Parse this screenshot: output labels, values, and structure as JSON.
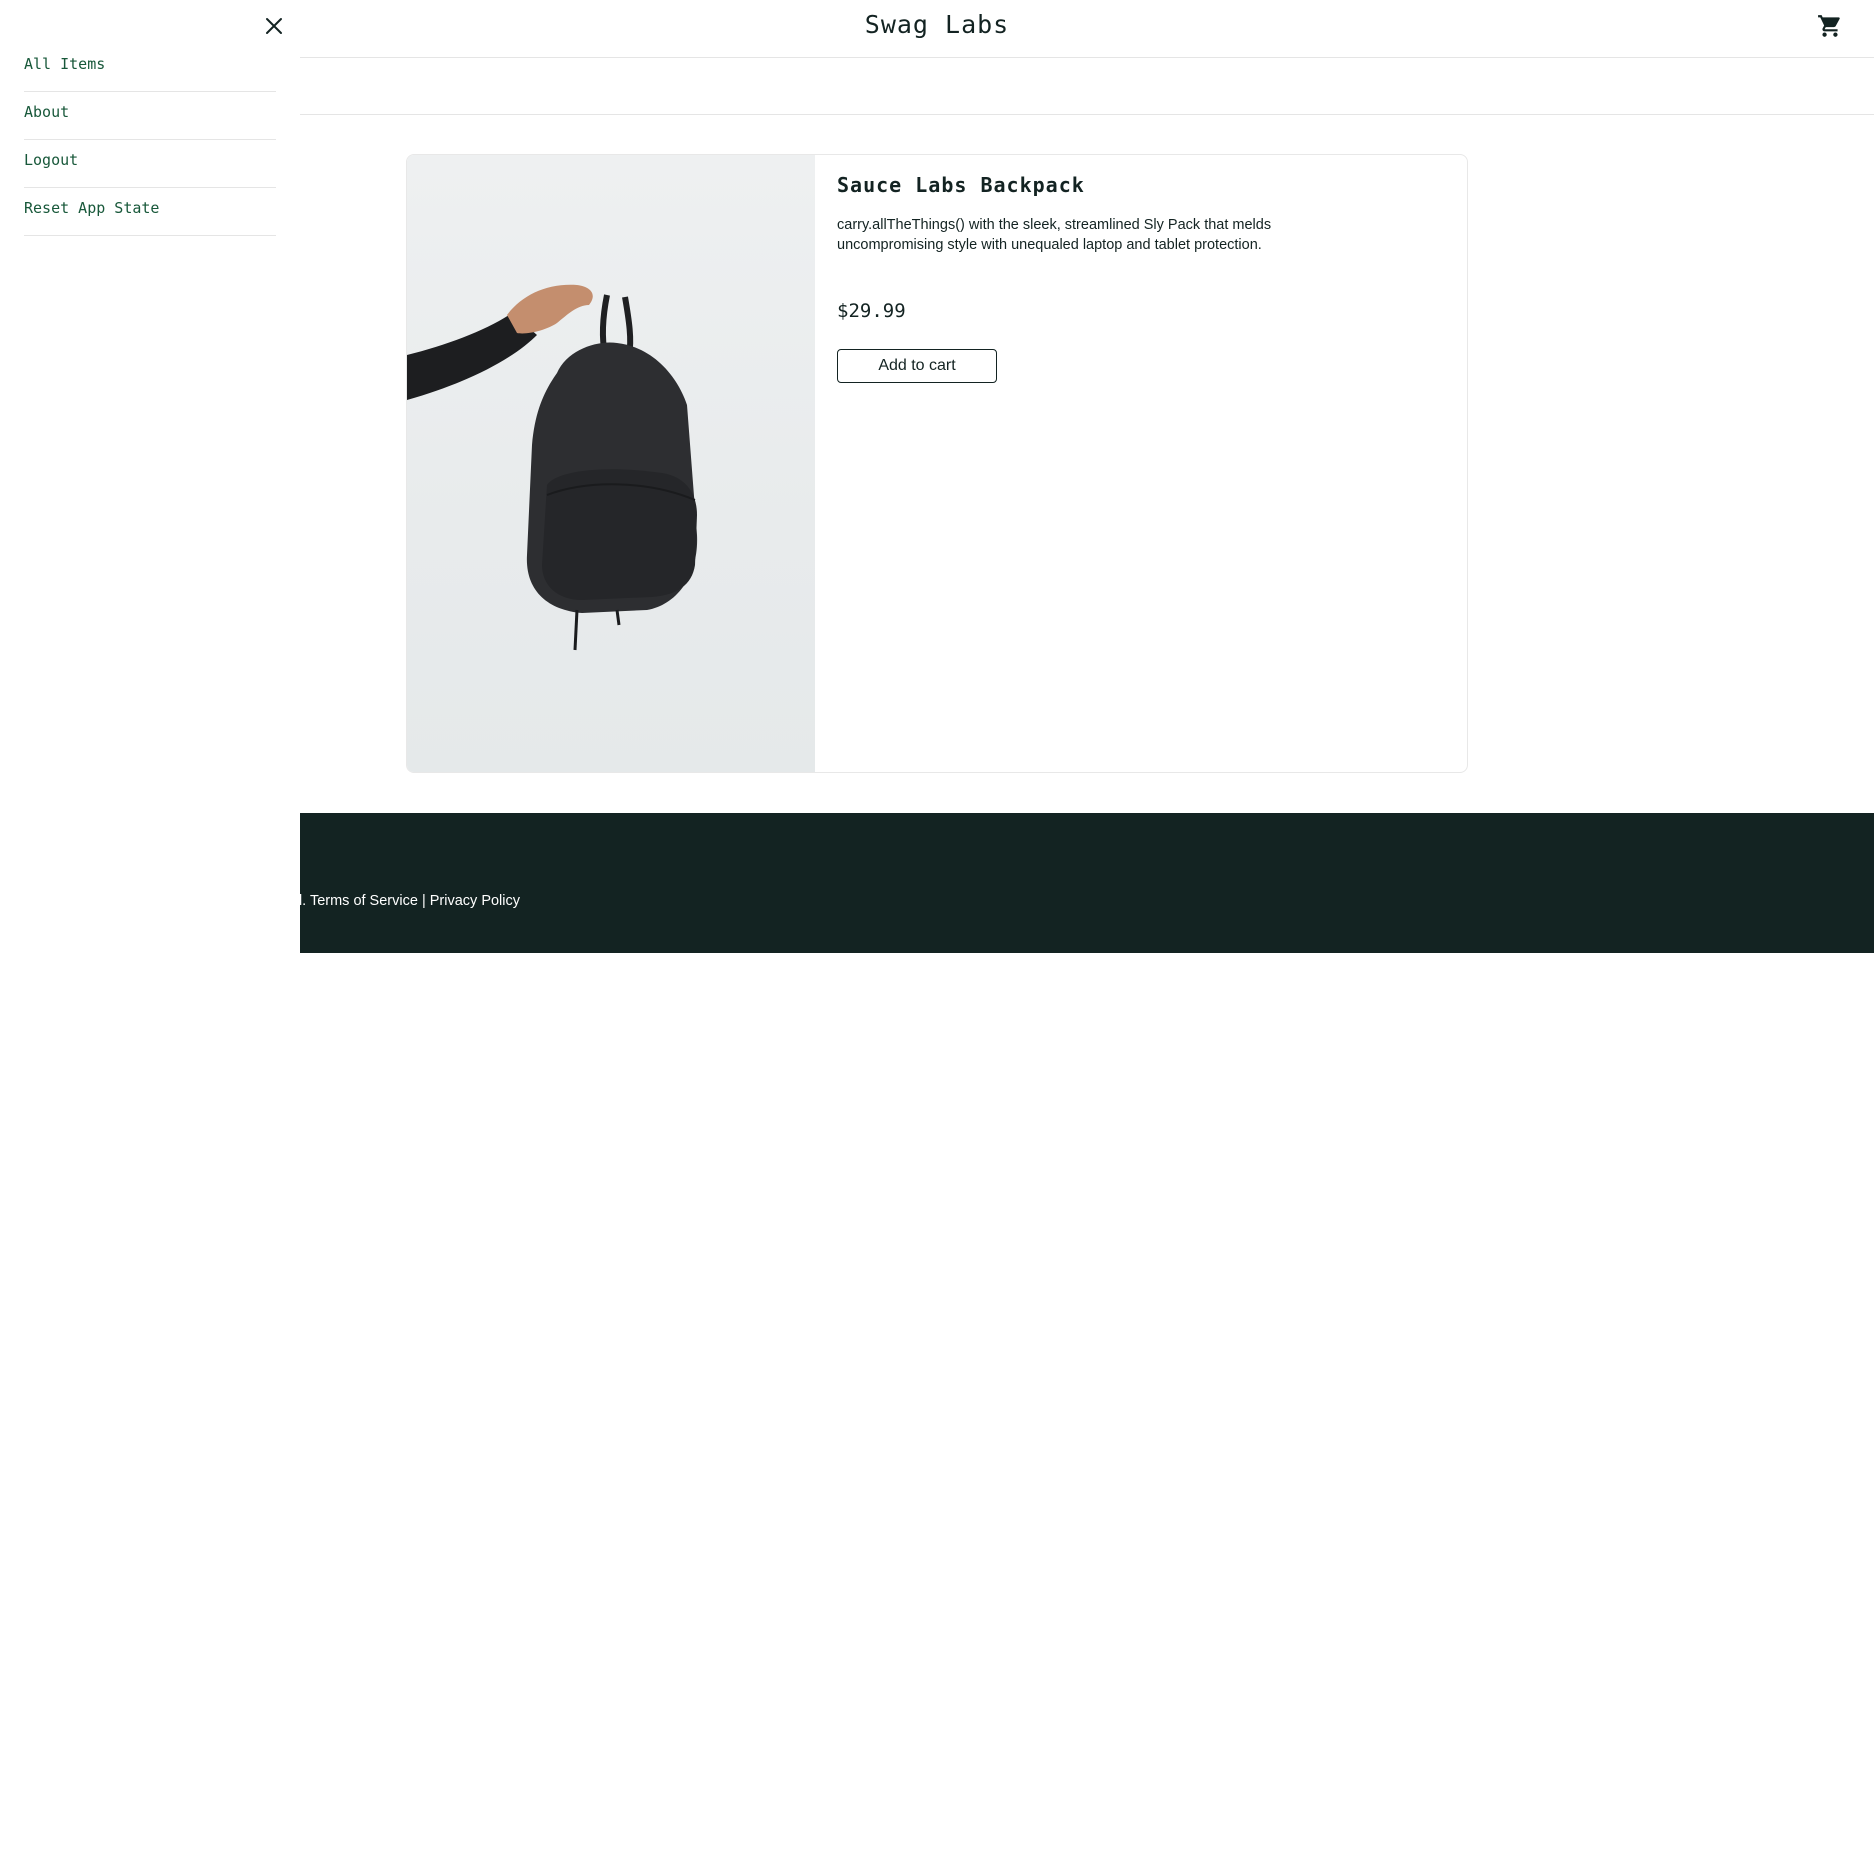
{
  "header": {
    "title": "Swag Labs",
    "cart_icon": "shopping-cart-icon"
  },
  "side_menu": {
    "close_icon": "close-icon",
    "items": [
      {
        "label": "All Items"
      },
      {
        "label": "About"
      },
      {
        "label": "Logout"
      },
      {
        "label": "Reset App State"
      }
    ]
  },
  "product": {
    "name": "Sauce Labs Backpack",
    "description": "carry.allTheThings() with the sleek, streamlined Sly Pack that melds uncompromising style with unequaled laptop and tablet protection.",
    "price": "$29.99",
    "add_to_cart_label": "Add to cart"
  },
  "footer": {
    "text_fragment": "d. ",
    "terms_label": "Terms of Service",
    "separator": " | ",
    "privacy_label": "Privacy Policy"
  },
  "colors": {
    "brand_dark": "#132322",
    "menu_text": "#18583a",
    "border": "#e5e5e5"
  }
}
